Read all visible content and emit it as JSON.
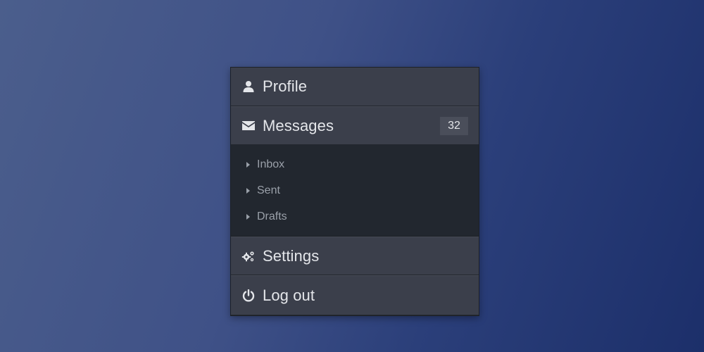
{
  "menu": {
    "items": [
      {
        "label": "Profile",
        "icon": "user-icon"
      },
      {
        "label": "Messages",
        "icon": "envelope-icon",
        "badge": "32",
        "submenu": [
          {
            "label": "Inbox"
          },
          {
            "label": "Sent"
          },
          {
            "label": "Drafts"
          }
        ]
      },
      {
        "label": "Settings",
        "icon": "gears-icon"
      },
      {
        "label": "Log out",
        "icon": "power-icon"
      }
    ]
  },
  "colors": {
    "menu_item_bg": "#3b3f4b",
    "submenu_bg": "#22272f",
    "text_light": "#e4e6ea",
    "text_muted": "#9aa0a9",
    "badge_bg": "#4a4e5a"
  }
}
